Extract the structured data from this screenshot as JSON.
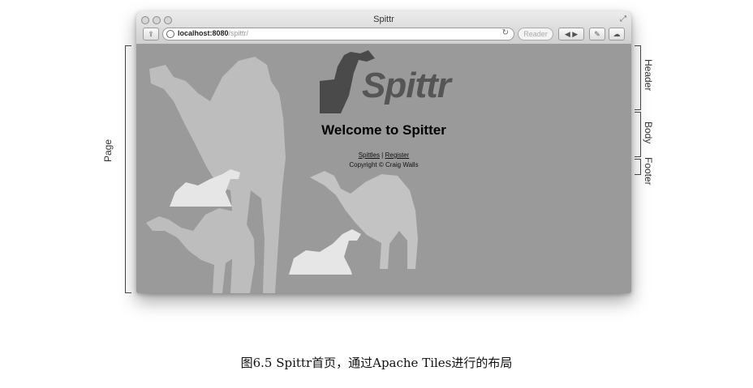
{
  "browser": {
    "window_title": "Spittr",
    "url_host": "localhost:8080",
    "url_path": "/spittr/",
    "reader_label": "Reader",
    "reload_icon": "↻",
    "nav_back": "◀",
    "nav_forward": "▶",
    "share_icon": "⇪",
    "tools_icon": "✎",
    "cloud_icon": "☁",
    "fullscreen_icon": "⤢"
  },
  "page": {
    "logo_text": "Spittr",
    "welcome": "Welcome to Spitter",
    "link_spittles": "Spittles",
    "link_separator": " | ",
    "link_register": "Register",
    "copyright": "Copyright © Craig Walls"
  },
  "annotations": {
    "page": "Page",
    "header": "Header",
    "body": "Body",
    "footer": "Footer"
  },
  "caption": "图6.5   Spittr首页，通过Apache Tiles进行的布局"
}
